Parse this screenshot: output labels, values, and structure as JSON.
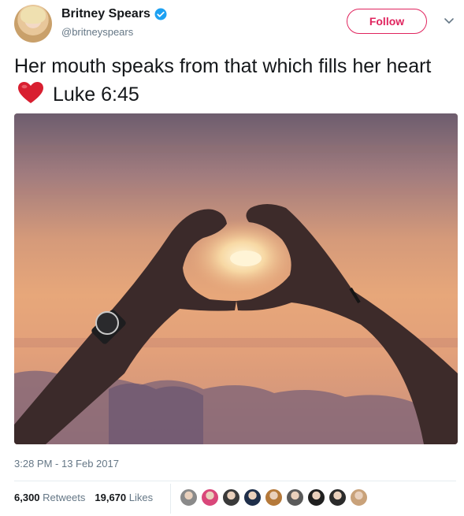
{
  "author": {
    "name": "Britney Spears",
    "handle": "@britneyspears",
    "verified_icon": "verified-badge-icon"
  },
  "header": {
    "follow_label": "Follow",
    "menu_icon": "chevron-down-icon"
  },
  "tweet": {
    "text_before": "Her mouth speaks from that which fills her heart",
    "emoji": "red-heart-icon",
    "text_after": "Luke 6:45",
    "media_icon": "heart-hands-sunset-photo"
  },
  "meta": {
    "timestamp": "3:28 PM - 13 Feb 2017"
  },
  "stats": {
    "retweets_count": "6,300",
    "retweets_label": "Retweets",
    "likes_count": "19,670",
    "likes_label": "Likes"
  },
  "colors": {
    "accent": "#e0245e",
    "verified": "#1da1f2",
    "muted": "#657786",
    "text": "#14171a"
  },
  "likers": [
    {
      "name": "liker-avatar-1",
      "color": "#8a8a8a"
    },
    {
      "name": "liker-avatar-2",
      "color": "#d9477a"
    },
    {
      "name": "liker-avatar-3",
      "color": "#3a3a3a"
    },
    {
      "name": "liker-avatar-4",
      "color": "#1f2f4a"
    },
    {
      "name": "liker-avatar-5",
      "color": "#b5793a"
    },
    {
      "name": "liker-avatar-6",
      "color": "#5a5a5a"
    },
    {
      "name": "liker-avatar-7",
      "color": "#202020"
    },
    {
      "name": "liker-avatar-8",
      "color": "#2b2b2b"
    },
    {
      "name": "liker-avatar-9",
      "color": "#c9a27a"
    }
  ]
}
